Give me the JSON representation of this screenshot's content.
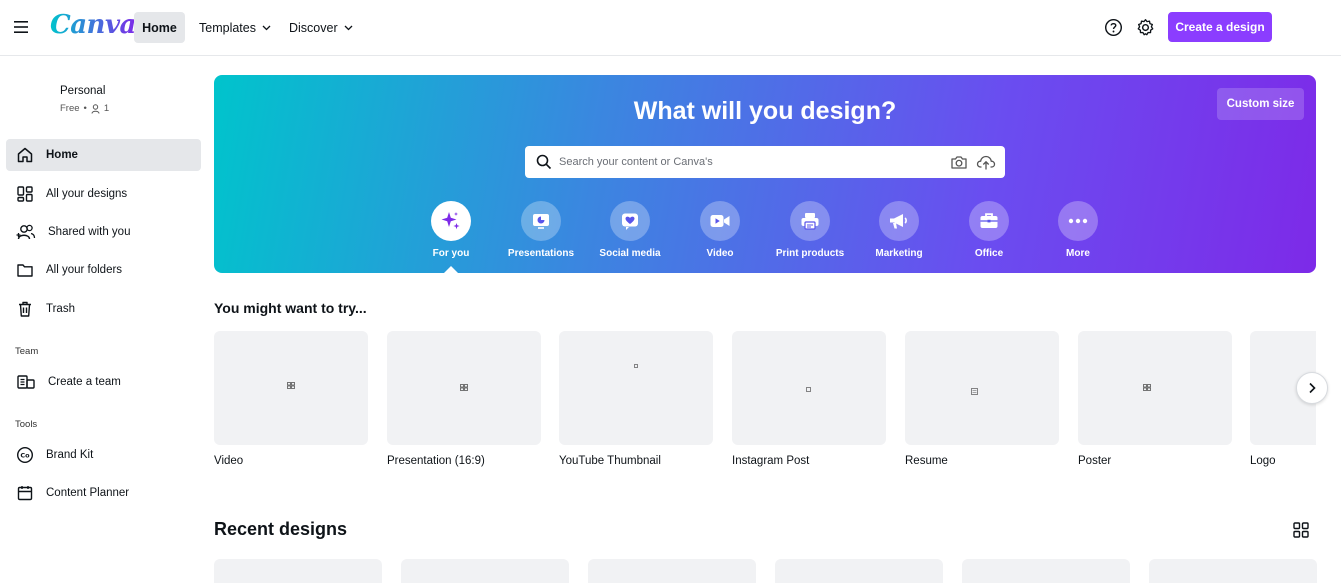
{
  "app": {
    "logo_text": "Canva",
    "brand_color": "#8b3dff"
  },
  "topbar": {
    "menu_icon": "hamburger-icon",
    "nav": [
      {
        "label": "Home",
        "active": true
      },
      {
        "label": "Templates",
        "has_dropdown": true
      },
      {
        "label": "Discover",
        "has_dropdown": true
      }
    ],
    "help_icon": "help-circle-icon",
    "settings_icon": "gear-icon",
    "create_button": "Create a design"
  },
  "sidebar": {
    "account": {
      "name": "Personal",
      "plan": "Free",
      "members": "1"
    },
    "items": [
      {
        "label": "Home",
        "icon": "home-icon",
        "active": true
      },
      {
        "label": "All your designs",
        "icon": "grid-icon"
      },
      {
        "label": "Shared with you",
        "icon": "people-icon"
      },
      {
        "label": "All your folders",
        "icon": "folder-icon"
      },
      {
        "label": "Trash",
        "icon": "trash-icon"
      }
    ],
    "team_heading": "Team",
    "team_items": [
      {
        "label": "Create a team",
        "icon": "create-team-icon"
      }
    ],
    "tools_heading": "Tools",
    "tools_items": [
      {
        "label": "Brand Kit",
        "icon": "brand-kit-icon"
      },
      {
        "label": "Content Planner",
        "icon": "calendar-icon"
      }
    ]
  },
  "hero": {
    "title": "What will you design?",
    "custom_size": "Custom size",
    "search_placeholder": "Search your content or Canva's",
    "categories": [
      {
        "label": "For you",
        "icon": "sparkle-icon",
        "active": true
      },
      {
        "label": "Presentations",
        "icon": "presentation-icon"
      },
      {
        "label": "Social media",
        "icon": "heart-icon"
      },
      {
        "label": "Video",
        "icon": "video-camera-icon"
      },
      {
        "label": "Print products",
        "icon": "printer-icon"
      },
      {
        "label": "Marketing",
        "icon": "megaphone-icon"
      },
      {
        "label": "Office",
        "icon": "briefcase-icon"
      },
      {
        "label": "More",
        "icon": "more-icon"
      }
    ]
  },
  "suggestions": {
    "title": "You might want to try...",
    "items": [
      {
        "label": "Video"
      },
      {
        "label": "Presentation (16:9)"
      },
      {
        "label": "YouTube Thumbnail"
      },
      {
        "label": "Instagram Post"
      },
      {
        "label": "Resume"
      },
      {
        "label": "Poster"
      },
      {
        "label": "Logo"
      }
    ]
  },
  "recent": {
    "title": "Recent designs"
  }
}
